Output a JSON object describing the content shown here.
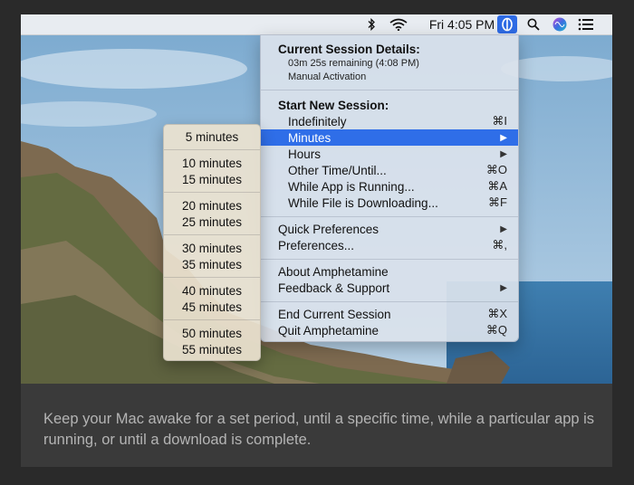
{
  "menubar": {
    "clock": "Fri 4:05 PM",
    "icons": [
      "bluetooth-icon",
      "wifi-icon",
      "amphetamine-icon",
      "spotlight-search-icon",
      "siri-icon",
      "notification-center-icon"
    ]
  },
  "menu": {
    "session_header": "Current Session Details:",
    "remaining": "03m 25s remaining (4:08 PM)",
    "activation": "Manual Activation",
    "new_session_header": "Start New Session:",
    "indefinitely": {
      "label": "Indefinitely",
      "shortcut": "⌘I"
    },
    "minutes": {
      "label": "Minutes"
    },
    "hours": {
      "label": "Hours"
    },
    "other_time": {
      "label": "Other Time/Until...",
      "shortcut": "⌘O"
    },
    "app_running": {
      "label": "While App is Running...",
      "shortcut": "⌘A"
    },
    "file_downloading": {
      "label": "While File is Downloading...",
      "shortcut": "⌘F"
    },
    "quick_prefs": {
      "label": "Quick Preferences"
    },
    "preferences": {
      "label": "Preferences...",
      "shortcut": "⌘,"
    },
    "about": {
      "label": "About Amphetamine"
    },
    "feedback": {
      "label": "Feedback & Support"
    },
    "end_session": {
      "label": "End Current Session",
      "shortcut": "⌘X"
    },
    "quit": {
      "label": "Quit Amphetamine",
      "shortcut": "⌘Q"
    }
  },
  "submenu": {
    "items": [
      "5 minutes",
      "10 minutes",
      "15 minutes",
      "20 minutes",
      "25 minutes",
      "30 minutes",
      "35 minutes",
      "40 minutes",
      "45 minutes",
      "50 minutes",
      "55 minutes"
    ]
  },
  "caption": "Keep your Mac awake for a set period, until a specific time, while a particular app is running, or until a download is complete.",
  "colors": {
    "highlight": "#2f6ee8",
    "accent_icon": "#2e6be5"
  }
}
